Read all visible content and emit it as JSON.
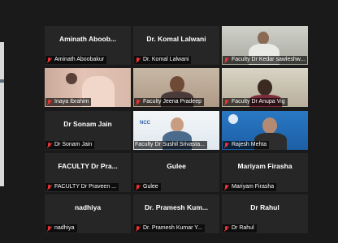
{
  "participants": [
    {
      "name_display": "Aminath Aboob...",
      "caption": "Aminath Aboobakur",
      "muted": true
    },
    {
      "name_display": "Dr. Komal Lalwani",
      "caption": "Dr. Komal Lalwani",
      "muted": true
    },
    {
      "caption": "Faculty Dr Kedar sawleshw...",
      "muted": true,
      "video": true,
      "active_speaker": true
    },
    {
      "caption": "Inaya Ibrahim",
      "muted": true,
      "video": true
    },
    {
      "caption": "Faculty Jeena Pradeep",
      "muted": true,
      "video": true
    },
    {
      "caption": "Faculty Dr Anupa Vig",
      "muted": true,
      "video": true
    },
    {
      "name_display": "Dr Sonam Jain",
      "caption": "Dr Sonam Jain",
      "muted": true
    },
    {
      "caption": "Faculty Dr Sushil Srivasta...",
      "muted": false,
      "video": true
    },
    {
      "caption": "Rajesh Mehta",
      "muted": true,
      "video": true
    },
    {
      "name_display": "FACULTY Dr Pra...",
      "caption": "FACULTY Dr Praveen ...",
      "muted": true
    },
    {
      "name_display": "Gulee",
      "caption": "Gulee",
      "muted": true
    },
    {
      "name_display": "Mariyam Firasha",
      "caption": "Mariyam Firasha",
      "muted": true
    },
    {
      "name_display": "nadhiya",
      "caption": "nadhiya",
      "muted": true
    },
    {
      "name_display": "Dr. Pramesh Kum...",
      "caption": "Dr. Pramesh Kumar Y...",
      "muted": true
    },
    {
      "name_display": "Dr Rahul",
      "caption": "Dr Rahul",
      "muted": true
    }
  ],
  "colors": {
    "background": "#1a1a1a",
    "tile": "#262626",
    "active_speaker_border": "#c8e23f",
    "muted_icon": "#ee3333"
  }
}
